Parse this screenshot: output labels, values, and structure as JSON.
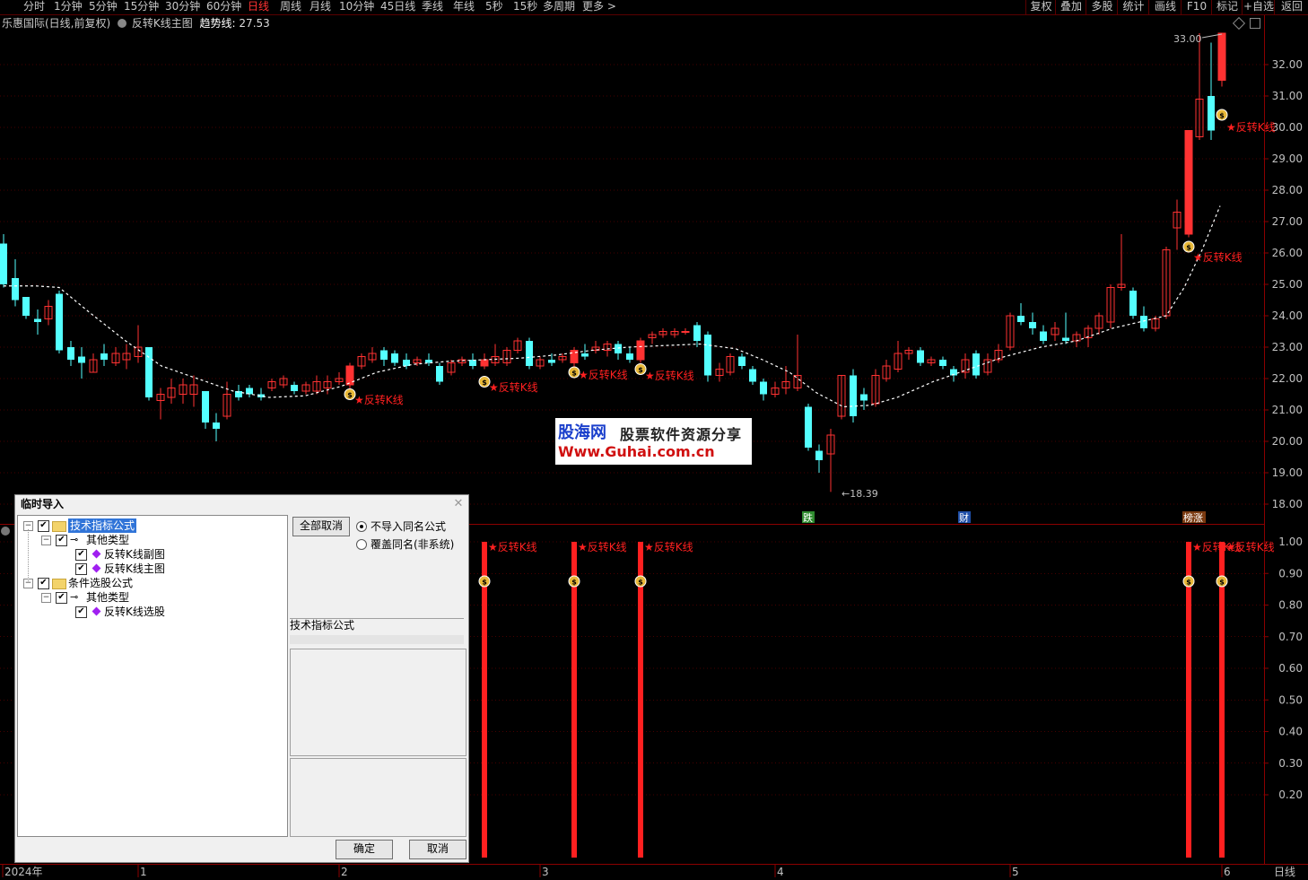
{
  "toolbar": {
    "periods": [
      "分时",
      "1分钟",
      "5分钟",
      "15分钟",
      "30分钟",
      "60分钟",
      "日线",
      "周线",
      "月线",
      "10分钟",
      "45日线",
      "季线",
      "年线",
      "5秒",
      "15秒",
      "多周期",
      "更多 >"
    ],
    "active_period": "日线",
    "right_buttons": [
      "复权",
      "叠加",
      "多股",
      "统计",
      "画线",
      "F10",
      "标记",
      "+自选",
      "返回"
    ]
  },
  "info": {
    "stock": "乐惠国际(日线,前复权)",
    "indicator": "反转K线主图",
    "trend_label": "趋势线:",
    "trend_value": "27.53"
  },
  "price_axis": [
    "32.00",
    "31.00",
    "30.00",
    "29.00",
    "28.00",
    "27.00",
    "26.00",
    "25.00",
    "24.00",
    "23.00",
    "22.00",
    "21.00",
    "20.00",
    "19.00",
    "18.00"
  ],
  "sub_axis": [
    "1.00",
    "0.90",
    "0.80",
    "0.70",
    "0.60",
    "0.50",
    "0.40",
    "0.30",
    "0.20"
  ],
  "time_axis": [
    "2024年",
    "1",
    "2",
    "3",
    "4",
    "5",
    "6"
  ],
  "period_label": "日线",
  "annotations": {
    "high": "33.00",
    "low": "18.39",
    "signal": "反转K线",
    "events": [
      "跌",
      "财",
      "榜涨"
    ]
  },
  "colors": {
    "up": "#ff3232",
    "down": "#54ffff",
    "trend": "#ffffff",
    "signal": "#ff2020",
    "axis": "#8b0000"
  },
  "chart_data": {
    "type": "candlestick",
    "title": "反转K线主图",
    "ylim": [
      17.6,
      33.5
    ],
    "signals": [
      "2024-02-19",
      "2024-03-06",
      "2024-03-13",
      "2024-05-27",
      "2024-05-30"
    ],
    "trend_last": 27.53,
    "high": 33.0,
    "low": 18.39
  },
  "dialog": {
    "title": "临时导入",
    "tree": [
      {
        "label": "技术指标公式",
        "level": 0,
        "folder": true,
        "selected": true
      },
      {
        "label": "其他类型",
        "level": 1,
        "folder": false
      },
      {
        "label": "反转K线副图",
        "level": 2,
        "leaf": true
      },
      {
        "label": "反转K线主图",
        "level": 2,
        "leaf": true
      },
      {
        "label": "条件选股公式",
        "level": 0,
        "folder": true
      },
      {
        "label": "其他类型",
        "level": 1,
        "folder": false
      },
      {
        "label": "反转K线选股",
        "level": 2,
        "leaf": true
      }
    ],
    "cancel_all": "全部取消",
    "radio1": "不导入同名公式",
    "radio2": "覆盖同名(非系统)",
    "category_label": "技术指标公式",
    "ok": "确定",
    "cancel": "取消"
  },
  "watermark": {
    "brand": "股海网",
    "slogan": "股票软件资源分享",
    "url": "Www.Guhai.com.cn"
  }
}
